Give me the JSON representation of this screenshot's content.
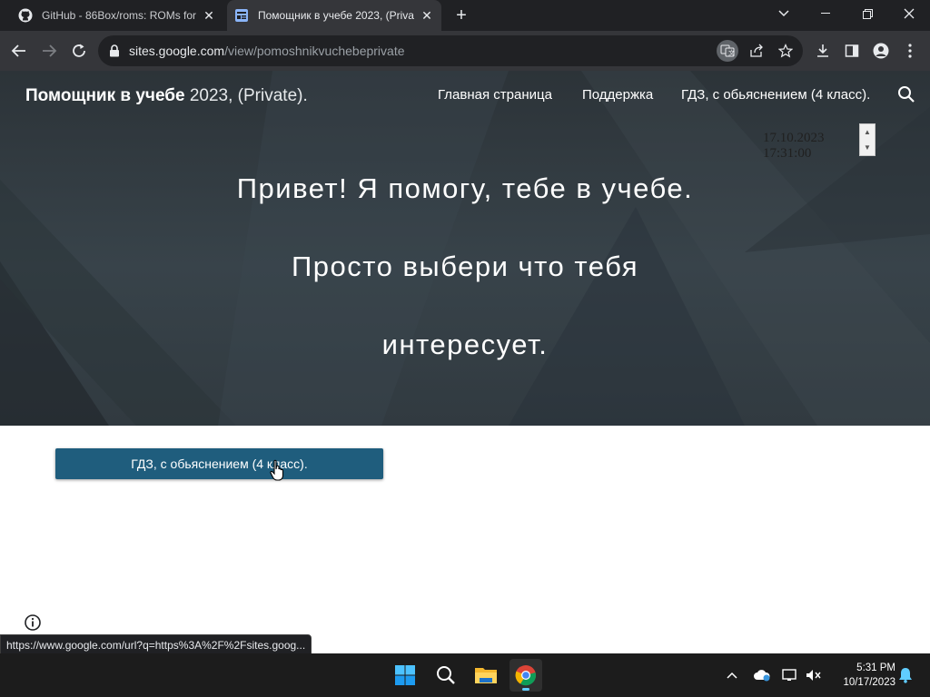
{
  "browser": {
    "tabs": [
      {
        "title": "GitHub - 86Box/roms: ROMs for",
        "icon": "github-icon"
      },
      {
        "title": "Помощник в учебе 2023, (Priva",
        "icon": "google-sites-icon"
      }
    ],
    "address": {
      "host": "sites.google.com",
      "path": "/view/pomoshnikvuchebeprivate"
    },
    "status_url": "https://www.google.com/url?q=https%3A%2F%2Fsites.goog..."
  },
  "site": {
    "title_bold": "Помощник в учебе",
    "title_rest": " 2023, (Private).",
    "nav": [
      "Главная страница",
      "Поддержка",
      "ГДЗ, с обьяснением (4 класс)."
    ],
    "datetime": {
      "date": "17.10.2023",
      "time": "17:31:00"
    },
    "hero_lines": [
      "Привет! Я помогу, тебе в учебе.",
      "Просто выбери что тебя",
      "интересует."
    ],
    "button_label": "ГДЗ, с обьяснением (4 класс)."
  },
  "colors": {
    "accent_button": "#1f5d7d",
    "chrome_dark": "#202124",
    "chrome_toolbar": "#35363a"
  },
  "taskbar": {
    "apps": [
      "windows-start-icon",
      "search-icon",
      "file-explorer-icon",
      "chrome-icon"
    ],
    "clock": {
      "time": "5:31 PM",
      "date": "10/17/2023"
    }
  }
}
